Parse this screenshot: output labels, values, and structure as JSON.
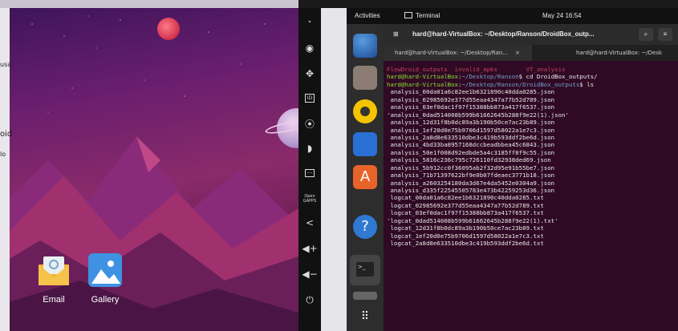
{
  "emulator": {
    "peek_labels": [
      "usa",
      "oid",
      "lo"
    ],
    "apps": [
      {
        "label": "Email",
        "icon": "email-icon"
      },
      {
        "label": "Gallery",
        "icon": "gallery-icon"
      }
    ],
    "toolbar": [
      {
        "name": "gps-icon",
        "glyph": "GPS"
      },
      {
        "name": "camera-icon",
        "glyph": "◉"
      },
      {
        "name": "dpad-icon",
        "glyph": "✥"
      },
      {
        "name": "id-icon",
        "glyph": "ID"
      },
      {
        "name": "record-icon",
        "glyph": "●"
      },
      {
        "name": "rss-icon",
        "glyph": "⌘"
      },
      {
        "name": "sms-icon",
        "glyph": "…"
      },
      {
        "name": "open-gapps-icon",
        "glyph": "Open GAPPS"
      },
      {
        "name": "share-icon",
        "glyph": "<"
      },
      {
        "name": "volume-up-icon",
        "glyph": "◄+"
      },
      {
        "name": "volume-down-icon",
        "glyph": "◄−"
      },
      {
        "name": "power-icon",
        "glyph": "⏻"
      }
    ]
  },
  "ubuntu": {
    "topbar": {
      "activities": "Activities",
      "app": "Terminal",
      "clock": "May 24  16:54"
    },
    "terminal": {
      "title": "hard@hard-VirtualBox: ~/Desktop/Ranson/DroidBox_outp...",
      "tabs": [
        "hard@hard-VirtualBox: ~/Desktop/Ran...",
        "hard@hard-VirtualBox: ~/Desk"
      ],
      "lines": [
        {
          "parts": [
            {
              "t": "FlowDroid_outputs  invalid_apks        VT_analysis",
              "c": "red"
            }
          ]
        },
        {
          "parts": [
            {
              "t": "hard@hard-VirtualBox",
              "c": "green"
            },
            {
              "t": ":",
              "c": "white"
            },
            {
              "t": "~/Desktop/Ranson",
              "c": "blue"
            },
            {
              "t": "$ cd DroidBox_outputs/",
              "c": "white"
            }
          ]
        },
        {
          "parts": [
            {
              "t": "hard@hard-VirtualBox",
              "c": "green"
            },
            {
              "t": ":",
              "c": "white"
            },
            {
              "t": "~/Desktop/Ranson/DroidBox_outputs",
              "c": "blue"
            },
            {
              "t": "$ ls",
              "c": "white"
            }
          ]
        },
        {
          "parts": [
            {
              "t": " analysis_00da01a6c82ee1b6321890c40dda0285.json",
              "c": "white"
            }
          ]
        },
        {
          "parts": [
            {
              "t": " analysis_02985692e377d55eaa4347a77b52d789.json",
              "c": "white"
            }
          ]
        },
        {
          "parts": [
            {
              "t": " analysis_03ef0dac1f97f15388bb873a417f6537.json",
              "c": "white"
            }
          ]
        },
        {
          "parts": [
            {
              "t": "'analysis_0dad514008b599b61662645b288f9e22(1).json'",
              "c": "white"
            }
          ]
        },
        {
          "parts": [
            {
              "t": " analysis_12d31f8b0dc89a3b190b50ce7ac23b89.json",
              "c": "white"
            }
          ]
        },
        {
          "parts": [
            {
              "t": " analysis_1ef20d0e75b9706d1597d58022a1e7c3.json",
              "c": "white"
            }
          ]
        },
        {
          "parts": [
            {
              "t": " analysis_2a8d8e633510dbe3c419b593ddf2be6d.json",
              "c": "white"
            }
          ]
        },
        {
          "parts": [
            {
              "t": " analysis_4bd33ba8957168dccbeadbbea45c6843.json",
              "c": "white"
            }
          ]
        },
        {
          "parts": [
            {
              "t": " analysis_50e1f008d92edbde5a4c3185ff8f9c55.json",
              "c": "white"
            }
          ]
        },
        {
          "parts": [
            {
              "t": " analysis_5816c236c795c726110fd32938ded69.json",
              "c": "white"
            }
          ]
        },
        {
          "parts": [
            {
              "t": " analysis_5b912cc0f36095ab2f32d95e91b55be7.json",
              "c": "white"
            }
          ]
        },
        {
          "parts": [
            {
              "t": " analysis_71b71397622bf9e0b07fdeaec3771b18.json",
              "c": "white"
            }
          ]
        },
        {
          "parts": [
            {
              "t": " analysis_a2603254180da3d67e4da5452e0304a9.json",
              "c": "white"
            }
          ]
        },
        {
          "parts": [
            {
              "t": " analysis_d335f22545505783e473b42259253d36.json",
              "c": "white"
            }
          ]
        },
        {
          "parts": [
            {
              "t": " logcat_00da01a6c82ee1b6321890c40dda0285.txt",
              "c": "white"
            }
          ]
        },
        {
          "parts": [
            {
              "t": " logcat_02985692e377d55eaa4347a77b52d789.txt",
              "c": "white"
            }
          ]
        },
        {
          "parts": [
            {
              "t": " logcat_03ef0dac1f97f15388bb873a417f6537.txt",
              "c": "white"
            }
          ]
        },
        {
          "parts": [
            {
              "t": "'logcat_0dad514008b599b61662645b288f9e22(1).txt'",
              "c": "white"
            }
          ]
        },
        {
          "parts": [
            {
              "t": " logcat_12d31f8b0dc89a3b190b50ce7ac23b89.txt",
              "c": "white"
            }
          ]
        },
        {
          "parts": [
            {
              "t": " logcat_1ef20d0e75b9706d1597d58022a1e7c3.txt",
              "c": "white"
            }
          ]
        },
        {
          "parts": [
            {
              "t": " logcat_2a8d8e633510dbe3c419b593ddf2be6d.txt",
              "c": "white"
            }
          ]
        }
      ]
    }
  },
  "colors": {
    "prompt_user": "#8ae234",
    "prompt_path": "#729fcf",
    "dir_listing": "#c0455a",
    "terminal_bg": "#300a24"
  }
}
